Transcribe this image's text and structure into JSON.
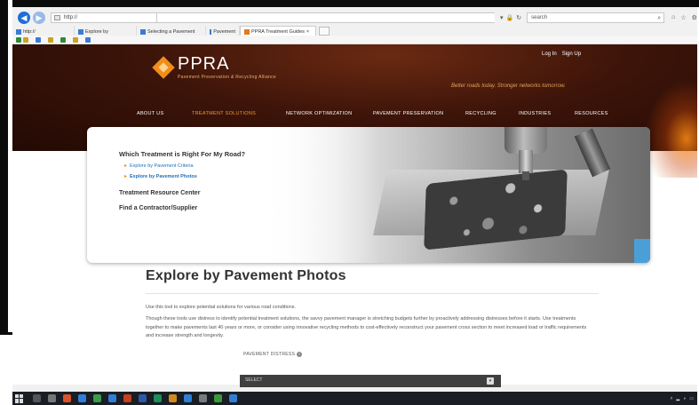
{
  "browser": {
    "tabs": [
      {
        "label": "http://"
      },
      {
        "label": "Explore by"
      },
      {
        "label": "Selecting a Pavement"
      },
      {
        "label": "Pavement"
      },
      {
        "label": "PPRA Treatment Guides"
      }
    ],
    "address_text": "http://",
    "search_text": "search"
  },
  "site": {
    "logo_name": "PPRA",
    "logo_sub": "Pavement Preservation & Recycling Alliance",
    "login": "Log In",
    "signup": "Sign Up",
    "tagline": "Better roads today. Stronger networks tomorrow.",
    "nav": [
      {
        "label": "ABOUT US",
        "active": false
      },
      {
        "label": "TREATMENT SOLUTIONS",
        "active": true
      },
      {
        "label": "NETWORK OPTIMIZATION",
        "active": false
      },
      {
        "label": "PAVEMENT PRESERVATION",
        "active": false
      },
      {
        "label": "RECYCLING",
        "active": false
      },
      {
        "label": "INDUSTRIES",
        "active": false
      },
      {
        "label": "RESOURCES",
        "active": false
      }
    ],
    "hero": {
      "question": "Which Treatment is Right For My Road?",
      "sub1": "Explore by Pavement Criteria",
      "sub2": "Explore by Pavement Photos",
      "heading1": "Treatment Resource Center",
      "heading2": "Find a Contractor/Supplier"
    },
    "page_title": "Explore by Pavement Photos",
    "intro": "Use this tool to explore potential solutions for various road conditions.",
    "paragraph": "Though these tools use distress to identify potential treatment solutions, the savvy pavement manager is stretching budgets further by proactively addressing distresses before it starts. Use treatments together to make pavements last 40 years or more, or consider using innovative recycling methods to cost-effectively reconstruct your pavement cross section to meet increased load or traffic requirements and increase strength and longevity.",
    "field_label": "PAVEMENT DISTRESS",
    "select_value": "SELECT"
  },
  "colors": {
    "accent_orange": "#f08a1b",
    "link_blue": "#1f6fb7",
    "header_dark": "#3d1409"
  }
}
